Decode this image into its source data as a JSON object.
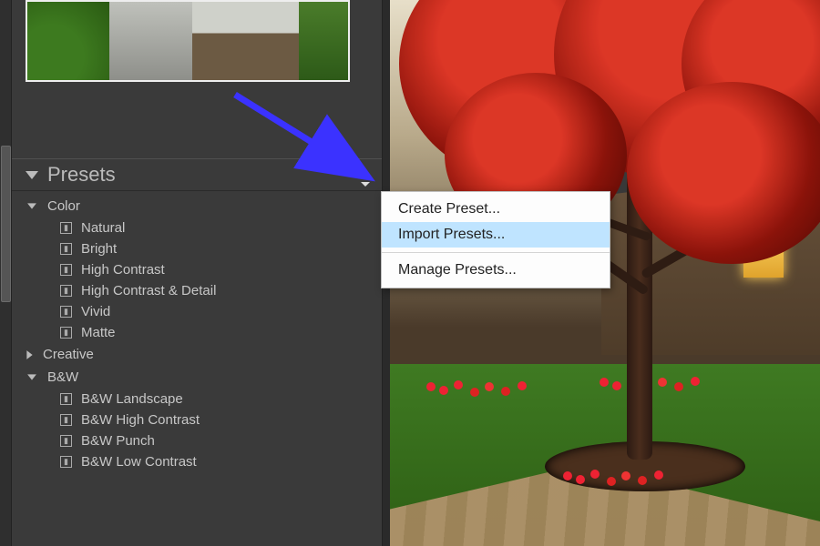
{
  "panel": {
    "title": "Presets"
  },
  "groups": [
    {
      "name": "Color",
      "expanded": true,
      "presets": [
        "Natural",
        "Bright",
        "High Contrast",
        "High Contrast & Detail",
        "Vivid",
        "Matte"
      ]
    },
    {
      "name": "Creative",
      "expanded": false,
      "presets": []
    },
    {
      "name": "B&W",
      "expanded": true,
      "presets": [
        "B&W Landscape",
        "B&W High Contrast",
        "B&W Punch",
        "B&W Low Contrast"
      ]
    }
  ],
  "context_menu": {
    "items": [
      "Create Preset...",
      "Import Presets...",
      "Manage Presets..."
    ],
    "selected_index": 1,
    "separator_after": [
      1
    ]
  }
}
